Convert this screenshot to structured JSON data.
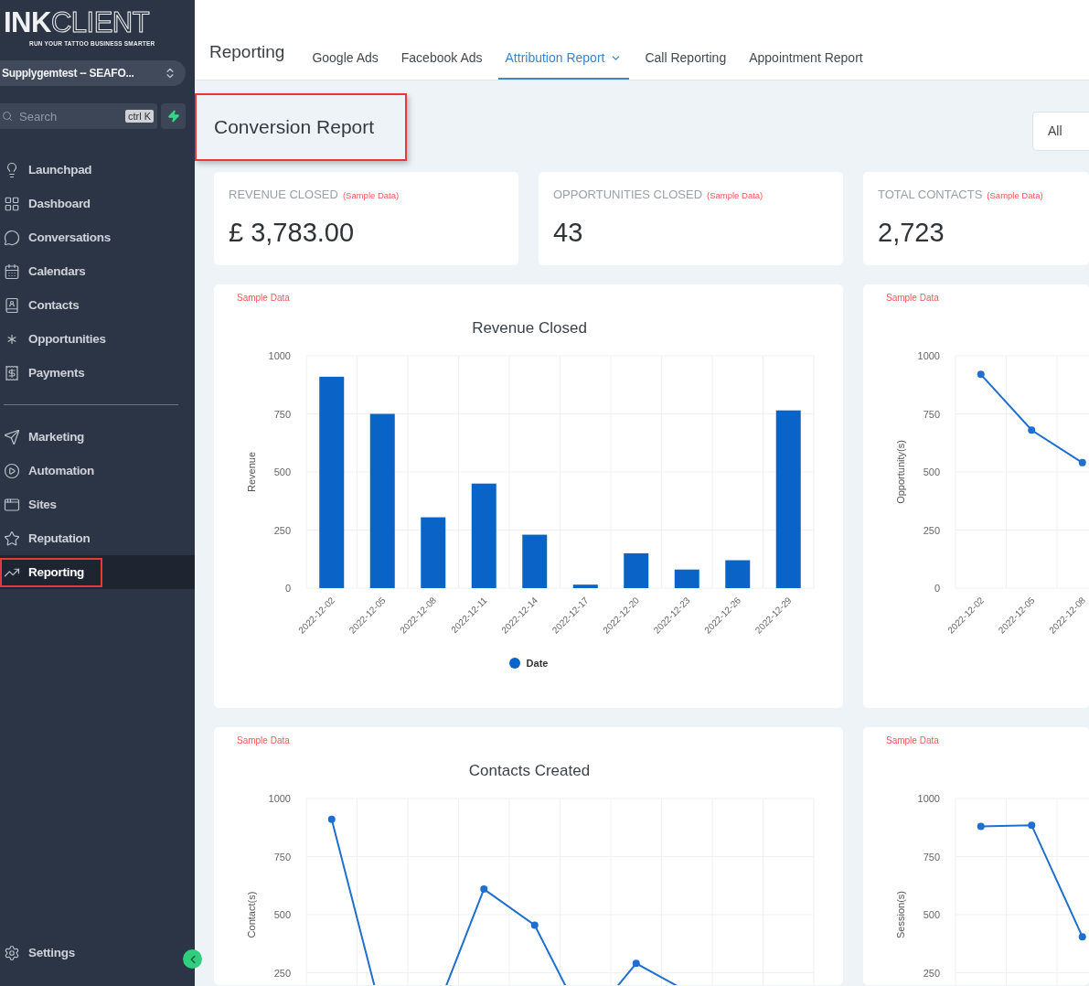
{
  "sidebar": {
    "logo": {
      "part_1": "INK",
      "part_2": "CLIENT",
      "tagline": "RUN YOUR TATTOO BUSINESS SMARTER"
    },
    "account": "Supplygemtest -- SEAFO...",
    "search": {
      "placeholder": "Search",
      "shortcut": "ctrl K"
    },
    "sections": [
      {
        "items": [
          {
            "label": "Launchpad",
            "selected": false,
            "highlighted": false
          },
          {
            "label": "Dashboard",
            "selected": false,
            "highlighted": false
          },
          {
            "label": "Conversations",
            "selected": false,
            "highlighted": false
          },
          {
            "label": "Calendars",
            "selected": false,
            "highlighted": false
          },
          {
            "label": "Contacts",
            "selected": false,
            "highlighted": false
          },
          {
            "label": "Opportunities",
            "selected": false,
            "highlighted": false
          },
          {
            "label": "Payments",
            "selected": false,
            "highlighted": false
          }
        ]
      },
      {
        "items": [
          {
            "label": "Marketing",
            "selected": false,
            "highlighted": false
          },
          {
            "label": "Automation",
            "selected": false,
            "highlighted": false
          },
          {
            "label": "Sites",
            "selected": false,
            "highlighted": false
          },
          {
            "label": "Reputation",
            "selected": false,
            "highlighted": false
          },
          {
            "label": "Reporting",
            "selected": true,
            "highlighted": true
          }
        ]
      }
    ],
    "footer_item": {
      "label": "Settings"
    }
  },
  "topbar": {
    "title": "Reporting",
    "tabs": [
      {
        "label": "Google Ads",
        "selected": false,
        "dropdown": false
      },
      {
        "label": "Facebook Ads",
        "selected": false,
        "dropdown": false
      },
      {
        "label": "Attribution Report",
        "selected": true,
        "dropdown": true
      },
      {
        "label": "Call Reporting",
        "selected": false,
        "dropdown": false
      },
      {
        "label": "Appointment Report",
        "selected": false,
        "dropdown": false
      }
    ]
  },
  "page": {
    "heading": "Conversion Report",
    "heading_highlighted": true,
    "filter": {
      "value": "All"
    }
  },
  "stats": [
    {
      "label": "REVENUE CLOSED",
      "note": "(Sample Data)",
      "value": "£ 3,783.00"
    },
    {
      "label": "OPPORTUNITIES CLOSED",
      "note": "(Sample Data)",
      "value": "43"
    },
    {
      "label": "TOTAL CONTACTS",
      "note": "(Sample Data)",
      "value": "2,723"
    }
  ],
  "charts": [
    {
      "note": "Sample Data",
      "chart_data": {
        "type": "bar",
        "title": "Revenue Closed",
        "ylabel": "Revenue",
        "grid": true,
        "categories": [
          "2022-12-02",
          "2022-12-05",
          "2022-12-08",
          "2022-12-11",
          "2022-12-14",
          "2022-12-17",
          "2022-12-20",
          "2022-12-23",
          "2022-12-26",
          "2022-12-29"
        ],
        "series": [
          {
            "name": "Date",
            "color": "#0a64c8",
            "values": [
              910,
              750,
              305,
              450,
              230,
              15,
              150,
              80,
              120,
              765
            ]
          }
        ],
        "ylim": [
          0,
          1000
        ],
        "yticks": [
          0,
          250,
          500,
          750,
          1000
        ]
      }
    },
    {
      "note": "Sample Data",
      "chart_data": {
        "type": "line",
        "ylabel": "Opportunity(s)",
        "categories": [
          "2022-12-02",
          "2022-12-05",
          "2022-12-08"
        ],
        "series": [
          {
            "color": "#1e6fce",
            "marker": true,
            "values": [
              920,
              680,
              540
            ]
          }
        ],
        "grid": true,
        "ylim": [
          0,
          1000
        ],
        "yticks": [
          0,
          250,
          500,
          750,
          1000
        ]
      }
    },
    {
      "note": "Sample Data",
      "chart_data": {
        "type": "line",
        "title": "Contacts Created",
        "ylabel": "Contact(s)",
        "grid": true,
        "series": [
          {
            "color": "#1e6fce",
            "marker": true,
            "values": [
              910,
              60,
              50,
              610,
              455,
              25,
              290,
              170
            ]
          }
        ],
        "ylim": [
          0,
          1000
        ],
        "yticks": [
          250,
          500,
          750,
          1000
        ]
      }
    },
    {
      "note": "Sample Data",
      "chart_data": {
        "type": "line",
        "ylabel": "Session(s)",
        "grid": true,
        "series": [
          {
            "color": "#1e6fce",
            "marker": true,
            "values": [
              880,
              885,
              405
            ]
          }
        ],
        "ylim": [
          0,
          1000
        ],
        "yticks": [
          250,
          500,
          750,
          1000
        ]
      }
    }
  ]
}
